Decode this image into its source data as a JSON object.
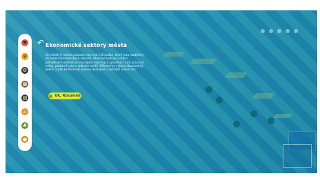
{
  "tutorial": {
    "back_icon": "back-arrow-icon",
    "title": "Ekonomické sektory města",
    "body": "Ve městě je možno postavit více než 130 budov, které jsou rozděleny do sedmi ekonomických sektorů. Všechny budovy v rámci jednotlivých sektorů se navzájem ovlivňují a vytvářejí v nich pracovní místa, podobně jako v reálném světě. Během hry vybírej ekonomický sektor a pak kontrolovat budovy dostupné v aktuální úrovni hry.",
    "confirm_label": "Ok, Rozumím"
  },
  "sidebar": {
    "items": [
      {
        "icon": "heart-icon",
        "color": "#e94e42"
      },
      {
        "icon": "shield-icon",
        "color": "#f4a300"
      },
      {
        "icon": "gear-icon",
        "color": "#333333"
      },
      {
        "icon": "building-icon",
        "color": "#7a5c2e"
      },
      {
        "icon": "factory-icon",
        "color": "#2f2f2f"
      },
      {
        "icon": "bank-icon",
        "color": "#f08a24"
      },
      {
        "icon": "plant-icon",
        "color": "#6a9a2a"
      },
      {
        "icon": "coin-icon",
        "color": "#d08a1a"
      }
    ]
  },
  "colors": {
    "accent_button": "#d7ef3f",
    "overlay": "#1f78b4",
    "text": "#ffffff"
  }
}
